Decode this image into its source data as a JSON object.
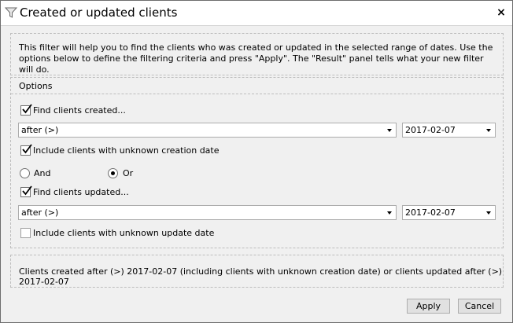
{
  "window": {
    "title": "Created or updated clients",
    "close_symbol": "×",
    "icons": {
      "title": "funnel-icon",
      "close": "close-icon"
    }
  },
  "description": "This filter will help you to find the clients who was created or updated in the selected range of dates. Use the options below to define the filtering criteria and press \"Apply\". The \"Result\" panel tells what your new filter will do.",
  "options": {
    "title": "Options",
    "find_created": {
      "label": "Find clients created...",
      "checked": true
    },
    "created_condition": {
      "value": "after (>)"
    },
    "created_date": {
      "value": "2017-02-07"
    },
    "include_unknown_creation": {
      "label": "Include clients with unknown creation date",
      "checked": true
    },
    "logic": {
      "and_label": "And",
      "or_label": "Or",
      "selected": "Or"
    },
    "find_updated": {
      "label": "Find clients updated...",
      "checked": true
    },
    "updated_condition": {
      "value": "after (>)"
    },
    "updated_date": {
      "value": "2017-02-07"
    },
    "include_unknown_update": {
      "label": "Include clients with unknown update date",
      "checked": false
    }
  },
  "result": {
    "text": "Clients created after (>) 2017-02-07 (including clients with unknown creation date) or clients updated after (>) 2017-02-07"
  },
  "buttons": {
    "apply": "Apply",
    "cancel": "Cancel"
  }
}
